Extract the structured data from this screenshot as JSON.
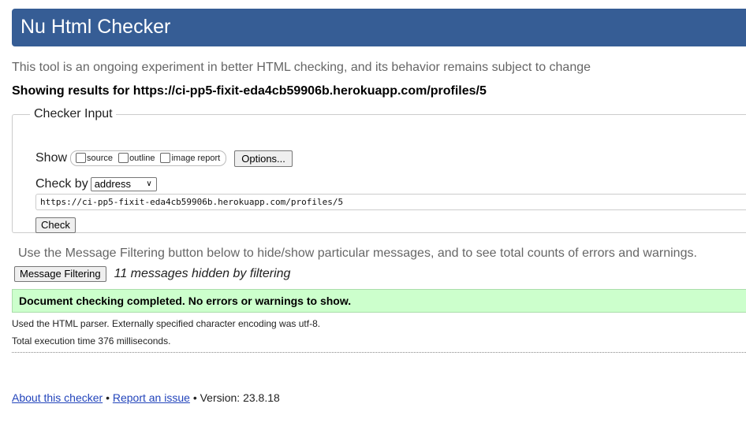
{
  "header": {
    "title": "Nu Html Checker"
  },
  "tagline": "This tool is an ongoing experiment in better HTML checking, and its behavior remains subject to change",
  "results_heading": "Showing results for https://ci-pp5-fixit-eda4cb59906b.herokuapp.com/profiles/5",
  "checker_input": {
    "legend": "Checker Input",
    "show_label": "Show",
    "show_options": [
      {
        "label": "source",
        "checked": false
      },
      {
        "label": "outline",
        "checked": false
      },
      {
        "label": "image report",
        "checked": false
      }
    ],
    "options_button": "Options...",
    "check_by_label": "Check by",
    "check_by_value": "address",
    "url_value": "https://ci-pp5-fixit-eda4cb59906b.herokuapp.com/profiles/5",
    "check_button": "Check"
  },
  "filtering": {
    "note": "Use the Message Filtering button below to hide/show particular messages, and to see total counts of errors and warnings.",
    "button": "Message Filtering",
    "hidden_count_text": "11 messages hidden by filtering"
  },
  "status": {
    "message": "Document checking completed. No errors or warnings to show.",
    "color": "#ccffcc"
  },
  "info": {
    "parser": "Used the HTML parser. Externally specified character encoding was utf-8.",
    "execution": "Total execution time 376 milliseconds."
  },
  "footer": {
    "about_link": "About this checker",
    "separator": "•",
    "report_link": "Report an issue",
    "version": "Version: 23.8.18"
  },
  "colors": {
    "header_bg": "#365d95",
    "link": "#2244bb"
  }
}
